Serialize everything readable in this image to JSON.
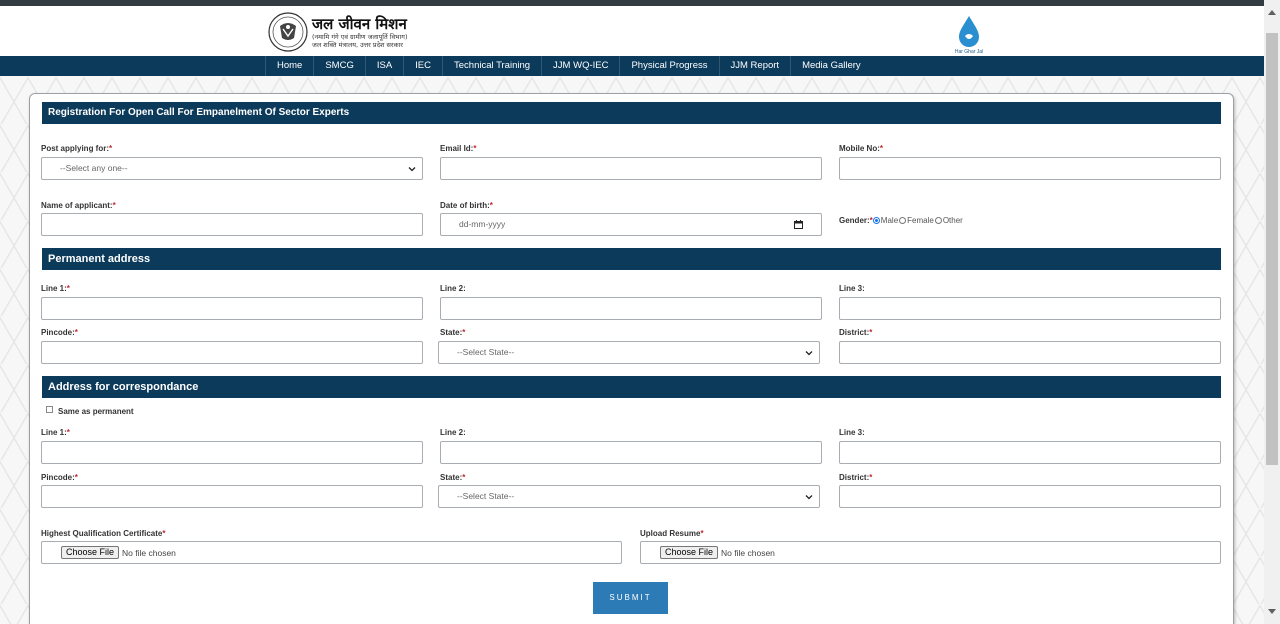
{
  "header": {
    "title": "जल जीवन मिशन",
    "subtitle_1": "(नमामि गंगे एवं ग्रामीण जलापूर्ति विभाग)",
    "subtitle_2": "जल शक्ति मंत्रालय, उत्तर प्रदेश सरकार",
    "right_logo_text": "Har Ghar Jal"
  },
  "nav": {
    "items": [
      "Home",
      "SMCG",
      "ISA",
      "IEC",
      "Technical Training",
      "JJM WQ-IEC",
      "Physical Progress",
      "JJM Report",
      "Media Gallery"
    ]
  },
  "form": {
    "section_title": "Registration For Open Call For Empanelment Of Sector Experts",
    "post_label": "Post applying for:",
    "post_placeholder": "--Select any one--",
    "email_label": "Email Id:",
    "mobile_label": "Mobile No:",
    "name_label": "Name of applicant:",
    "dob_label": "Date of birth:",
    "dob_placeholder": "dd-mm-yyyy",
    "gender_label": "Gender:",
    "gender_options": [
      "Male",
      "Female",
      "Other"
    ],
    "gender_selected": "Male",
    "required_mark": "*",
    "permanent": {
      "title": "Permanent address",
      "line1_label": "Line 1:",
      "line2_label": "Line 2:",
      "line3_label": "Line 3:",
      "pincode_label": "Pincode:",
      "state_label": "State:",
      "state_placeholder": "--Select State--",
      "district_label": "District:"
    },
    "correspondence": {
      "title": "Address for correspondance",
      "same_as_permanent": "Same as permanent",
      "line1_label": "Line 1:",
      "line2_label": "Line 2:",
      "line3_label": "Line 3:",
      "pincode_label": "Pincode:",
      "state_label": "State:",
      "state_placeholder": "--Select State--",
      "district_label": "District:"
    },
    "qualification_label": "Highest Qualification Certificate",
    "resume_label": "Upload Resume",
    "choose_file": "Choose File",
    "no_file": "No file chosen",
    "submit_label": "SUBMIT"
  },
  "colors": {
    "navy": "#0c3a5b",
    "submit_blue": "#2d7bb6",
    "required_red": "#c0282e"
  }
}
